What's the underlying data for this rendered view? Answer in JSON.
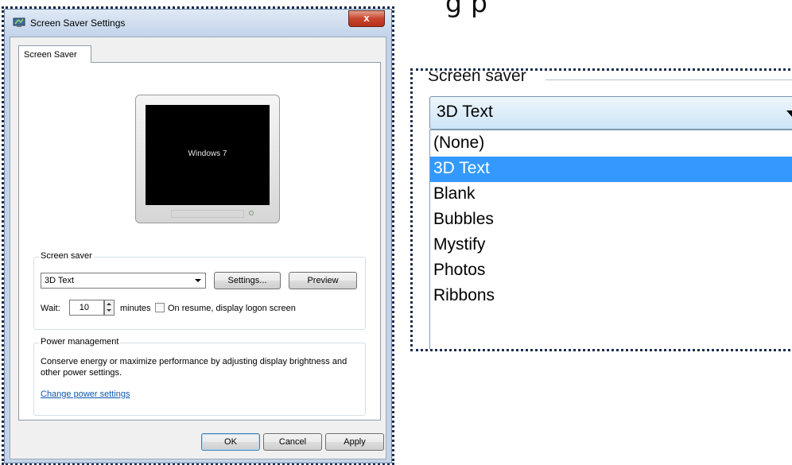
{
  "header_fragment": "g                    p",
  "dialog": {
    "title": "Screen Saver Settings",
    "close_label": "x",
    "tab_label": "Screen Saver",
    "preview_text": "Windows 7",
    "screen_saver_group": {
      "label": "Screen saver",
      "selected": "3D Text",
      "settings_label": "Settings...",
      "preview_label": "Preview",
      "wait_label": "Wait:",
      "wait_value": "10",
      "minutes_label": "minutes",
      "resume_label": "On resume, display logon screen",
      "resume_checked": false
    },
    "power_group": {
      "label": "Power management",
      "description": "Conserve energy or maximize performance by adjusting display brightness and other power settings.",
      "link": "Change power settings"
    },
    "buttons": {
      "ok": "OK",
      "cancel": "Cancel",
      "apply": "Apply"
    }
  },
  "zoomed_dropdown": {
    "label": "Screen saver",
    "selected": "3D Text",
    "options": [
      "(None)",
      "3D Text",
      "Blank",
      "Bubbles",
      "Mystify",
      "Photos",
      "Ribbons"
    ],
    "highlighted_index": 1,
    "highlight_color": "#3399ff"
  },
  "colors": {
    "frame_dots": "#1d2d4e",
    "link": "#0b58b0",
    "close_button": "#c7442d"
  }
}
